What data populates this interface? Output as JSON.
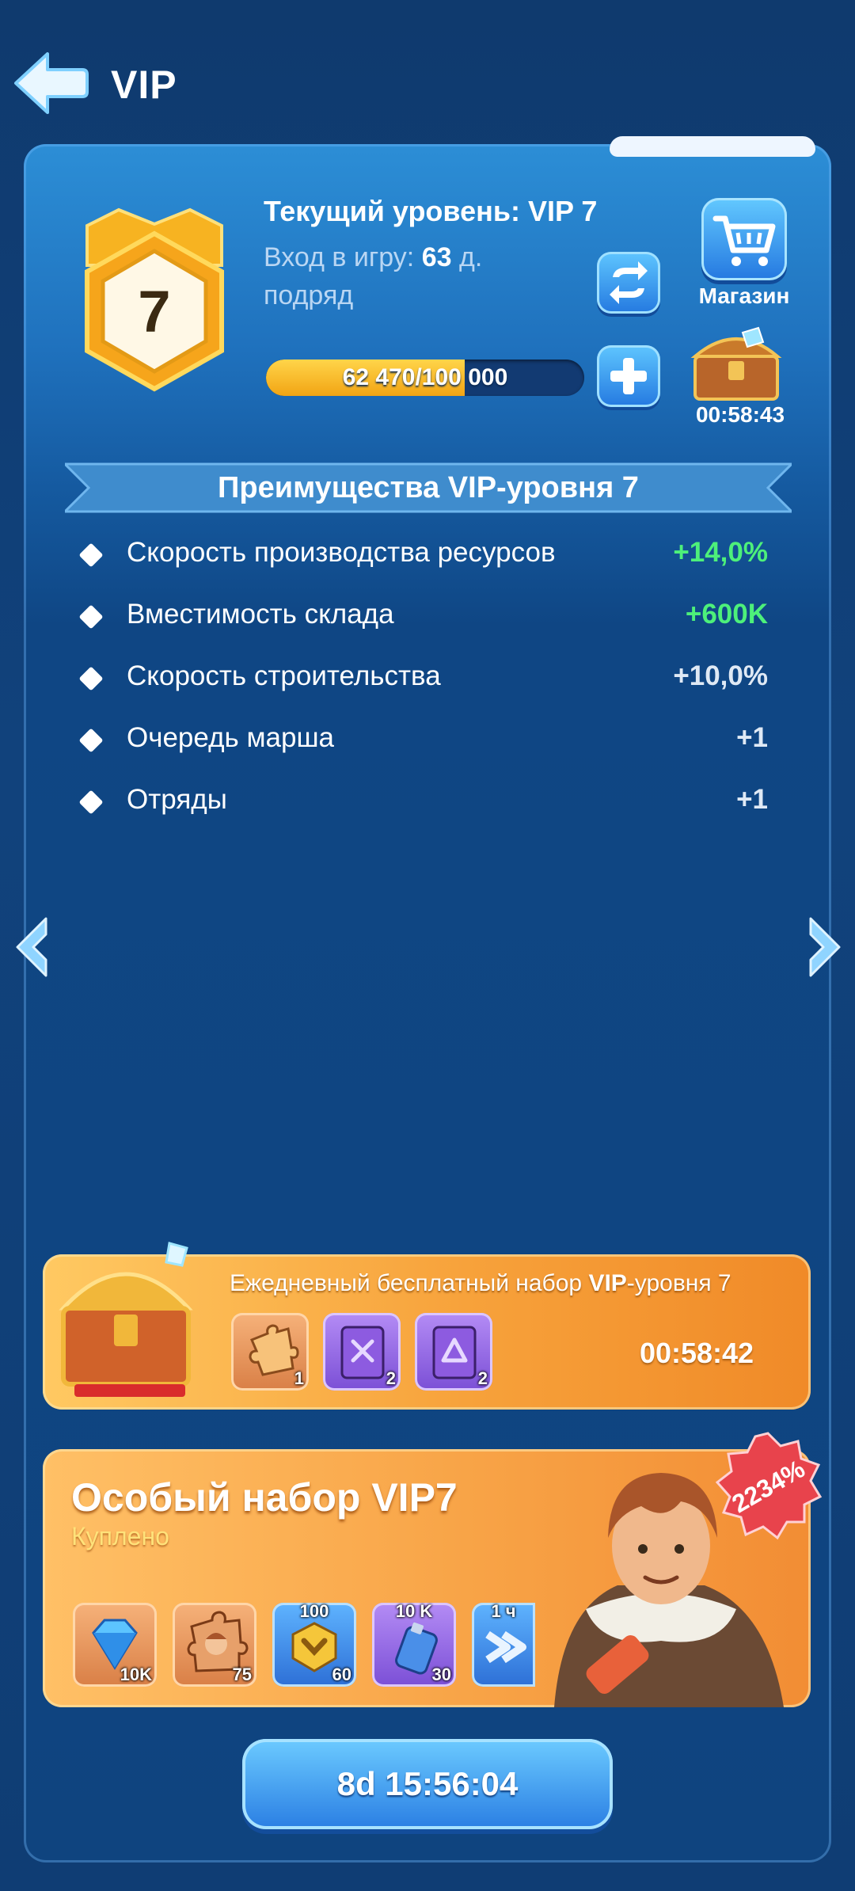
{
  "header": {
    "title": "VIP"
  },
  "vip": {
    "level_number": "7",
    "current_level_label": "Текущий уровень: VIP 7",
    "login_prefix": "Вход в игру:",
    "login_days": "63",
    "login_suffix": "д.",
    "login_line2": "подряд",
    "progress_text": "62 470/100 000",
    "progress_fraction": 0.6247,
    "shop_label": "Магазин",
    "chest_timer": "00:58:43"
  },
  "benefits": {
    "title": "Преимущества VIP-уровня 7",
    "items": [
      {
        "label": "Скорость производства ресурсов",
        "value": "+14,0%",
        "highlight": true
      },
      {
        "label": "Вместимость склада",
        "value": "+600K",
        "highlight": true
      },
      {
        "label": "Скорость строительства",
        "value": "+10,0%",
        "highlight": false
      },
      {
        "label": "Очередь марша",
        "value": "+1",
        "highlight": false
      },
      {
        "label": "Отряды",
        "value": "+1",
        "highlight": false
      }
    ]
  },
  "daily_pack": {
    "title_prefix": "Ежедневный бесплатный набор",
    "title_bold": "VIP",
    "title_suffix": "-уровня 7",
    "timer": "00:58:42",
    "items": [
      {
        "icon": "puzzle-piece-icon",
        "count": "1"
      },
      {
        "icon": "purple-skill-book-icon",
        "count": "2"
      },
      {
        "icon": "purple-tome-icon",
        "count": "2"
      }
    ]
  },
  "special_pack": {
    "title": "Особый набор VIP7",
    "status": "Куплено",
    "discount": "2234%",
    "items": [
      {
        "icon": "diamond-icon",
        "count": "10K",
        "top": ""
      },
      {
        "icon": "hero-puzzle-icon",
        "count": "75",
        "top": ""
      },
      {
        "icon": "rank-badge-icon",
        "count": "60",
        "top": "100"
      },
      {
        "icon": "exp-potion-icon",
        "count": "30",
        "top": "10 K"
      },
      {
        "icon": "speedup-icon",
        "count": "",
        "top": "1 ч"
      }
    ]
  },
  "event_timer": "8d 15:56:04",
  "colors": {
    "green_value": "#4df07a",
    "accent_blue": "#2a7ee3",
    "card_orange": "#f8a447"
  }
}
